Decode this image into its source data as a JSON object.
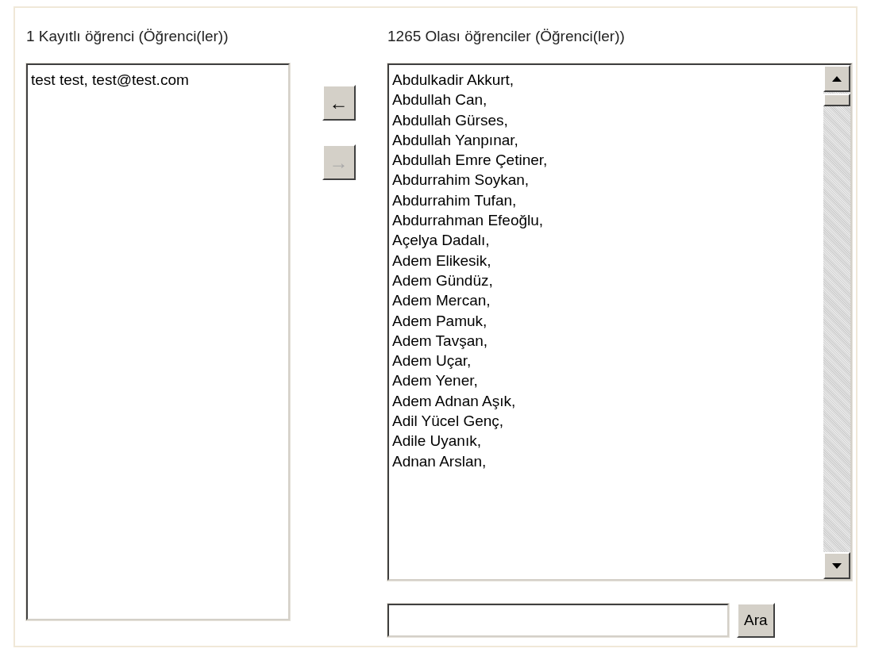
{
  "enrolled": {
    "heading": "1 Kayıtlı öğrenci (Öğrenci(ler))",
    "items": [
      "test test, test@test.com"
    ]
  },
  "move_buttons": [
    {
      "label": "←",
      "disabled": false
    },
    {
      "label": "→",
      "disabled": true
    }
  ],
  "candidates": {
    "heading": "1265 Olası öğrenciler (Öğrenci(ler))",
    "items": [
      "Abdulkadir Akkurt,",
      "Abdullah Can,",
      "Abdullah Gürses,",
      "Abdullah Yanpınar,",
      "Abdullah Emre Çetiner,",
      "Abdurrahim Soykan,",
      "Abdurrahim Tufan,",
      "Abdurrahman Efeoğlu,",
      "Açelya Dadalı,",
      "Adem Elikesik,",
      "Adem Gündüz,",
      "Adem Mercan,",
      "Adem Pamuk,",
      "Adem Tavşan,",
      "Adem Uçar,",
      "Adem Yener,",
      "Adem Adnan Aşık,",
      "Adil Yücel Genç,",
      "Adile Uyanık,",
      "Adnan Arslan,"
    ]
  },
  "search_button": "Ara"
}
